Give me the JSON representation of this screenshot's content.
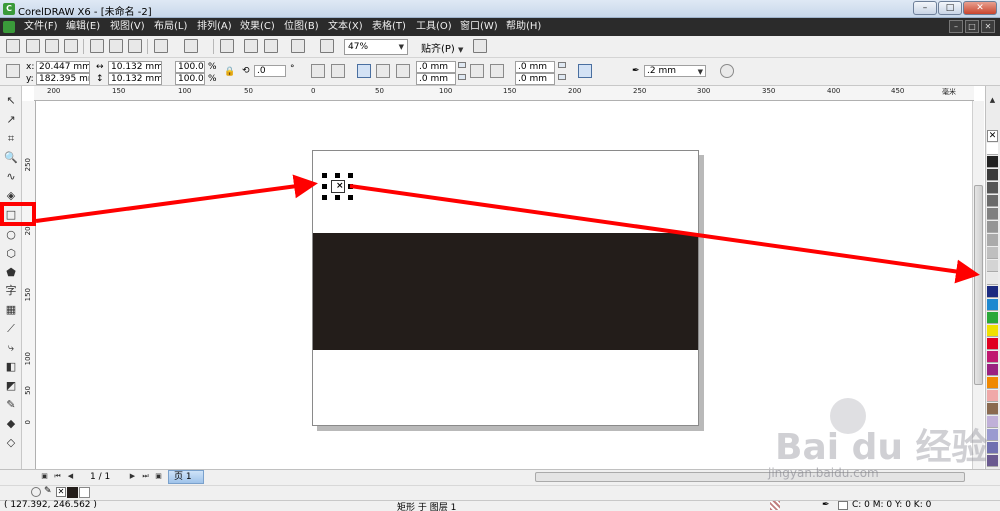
{
  "window": {
    "title": "CorelDRAW X6 - [未命名 -2]",
    "min": "–",
    "max": "□",
    "close": "✕"
  },
  "menu": [
    "文件(F)",
    "编辑(E)",
    "视图(V)",
    "布局(L)",
    "排列(A)",
    "效果(C)",
    "位图(B)",
    "文本(X)",
    "表格(T)",
    "工具(O)",
    "窗口(W)",
    "帮助(H)"
  ],
  "toolbar": {
    "zoom": "47%",
    "snap": "贴齐(P)"
  },
  "propbar": {
    "x_label": "x:",
    "x_value": "20.447 mm",
    "y_label": "y:",
    "y_value": "182.395 mm",
    "w_value": "10.132 mm",
    "h_value": "10.132 mm",
    "scale_w": "100.0",
    "scale_h": "100.0",
    "pct": "%",
    "rotation": ".0",
    "deg": "°",
    "corner1": ".0 mm",
    "corner2": ".0 mm",
    "corner3": ".0 mm",
    "corner4": ".0 mm",
    "outline": ".2 mm"
  },
  "ruler_h": [
    "200",
    "150",
    "100",
    "50",
    "0",
    "50",
    "100",
    "150",
    "200",
    "250",
    "300",
    "350",
    "400",
    "450"
  ],
  "ruler_h_unit": "毫米",
  "ruler_v": [
    "250",
    "200",
    "150",
    "100",
    "50",
    "0"
  ],
  "docbar": {
    "page_count": "1 / 1",
    "page_tab": "页 1"
  },
  "status": {
    "coords": "( 127.392, 246.562 )",
    "selection": "矩形 于 图层 1",
    "color": "C: 0 M: 0 Y: 0 K: 0"
  },
  "colors": {
    "band": "#231d1a",
    "arrow": "#ff0000",
    "menubar": "#2b2b2b"
  },
  "palette": [
    "#ffffff",
    "#222222",
    "#3a3a3a",
    "#555555",
    "#6a6a6a",
    "#808080",
    "#959595",
    "#aaaaaa",
    "#bfbfbf",
    "#d4d4d4",
    "#e8e8e8",
    "#1a2a80",
    "#1e88d0",
    "#28a838",
    "#f0e000",
    "#e00020",
    "#c01870",
    "#9a2080",
    "#f08800",
    "#f0a8a8",
    "#8a6a50",
    "#c0b0d8",
    "#9a9ad0",
    "#7070b0",
    "#6a5a90"
  ],
  "watermark": {
    "main": "Bai du 经验",
    "url": "jingyan.baidu.com"
  }
}
